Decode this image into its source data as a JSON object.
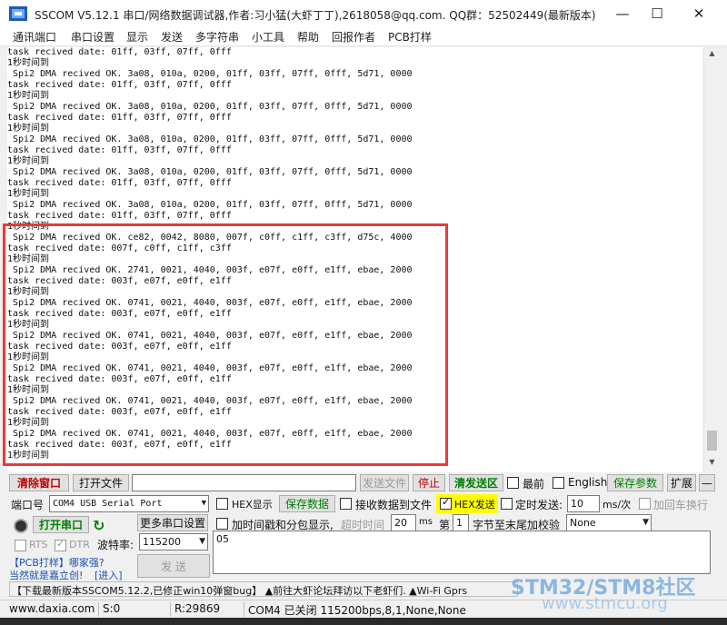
{
  "window": {
    "title": "SSCOM V5.12.1 串口/网络数据调试器,作者:习小猛(大虾丁丁),2618058@qq.com. QQ群：52502449(最新版本)",
    "controls": {
      "minimize": "—",
      "maximize": "☐",
      "close": "✕"
    }
  },
  "menu": [
    "通讯端口",
    "串口设置",
    "显示",
    "发送",
    "多字符串",
    "小工具",
    "帮助",
    "回报作者",
    "PCB打样"
  ],
  "log": [
    "task recived date: 01ff, 03ff, 07ff, 0fff",
    "1秒时间到",
    " Spi2 DMA recived OK. 3a08, 010a, 0200, 01ff, 03ff, 07ff, 0fff, 5d71, 0000",
    "task recived date: 01ff, 03ff, 07ff, 0fff",
    "1秒时间到",
    " Spi2 DMA recived OK. 3a08, 010a, 0200, 01ff, 03ff, 07ff, 0fff, 5d71, 0000",
    "task recived date: 01ff, 03ff, 07ff, 0fff",
    "1秒时间到",
    " Spi2 DMA recived OK. 3a08, 010a, 0200, 01ff, 03ff, 07ff, 0fff, 5d71, 0000",
    "task recived date: 01ff, 03ff, 07ff, 0fff",
    "1秒时间到",
    " Spi2 DMA recived OK. 3a08, 010a, 0200, 01ff, 03ff, 07ff, 0fff, 5d71, 0000",
    "task recived date: 01ff, 03ff, 07ff, 0fff",
    "1秒时间到",
    " Spi2 DMA recived OK. 3a08, 010a, 0200, 01ff, 03ff, 07ff, 0fff, 5d71, 0000",
    "task recived date: 01ff, 03ff, 07ff, 0fff",
    "1秒时间到",
    " Spi2 DMA recived OK. ce82, 0042, 8080, 007f, c0ff, c1ff, c3ff, d75c, 4000",
    "task recived date: 007f, c0ff, c1ff, c3ff",
    "1秒时间到",
    " Spi2 DMA recived OK. 2741, 0021, 4040, 003f, e07f, e0ff, e1ff, ebae, 2000",
    "task recived date: 003f, e07f, e0ff, e1ff",
    "1秒时间到",
    " Spi2 DMA recived OK. 0741, 0021, 4040, 003f, e07f, e0ff, e1ff, ebae, 2000",
    "task recived date: 003f, e07f, e0ff, e1ff",
    "1秒时间到",
    " Spi2 DMA recived OK. 0741, 0021, 4040, 003f, e07f, e0ff, e1ff, ebae, 2000",
    "task recived date: 003f, e07f, e0ff, e1ff",
    "1秒时间到",
    " Spi2 DMA recived OK. 0741, 0021, 4040, 003f, e07f, e0ff, e1ff, ebae, 2000",
    "task recived date: 003f, e07f, e0ff, e1ff",
    "1秒时间到",
    " Spi2 DMA recived OK. 0741, 0021, 4040, 003f, e07f, e0ff, e1ff, ebae, 2000",
    "task recived date: 003f, e07f, e0ff, e1ff",
    "1秒时间到",
    " Spi2 DMA recived OK. 0741, 0021, 4040, 003f, e07f, e0ff, e1ff, ebae, 2000",
    "task recived date: 003f, e07f, e0ff, e1ff",
    "1秒时间到"
  ],
  "toolbar": {
    "clear_window": "清除窗口",
    "open_file": "打开文件",
    "file_path": "",
    "send_file": "发送文件",
    "stop": "停止",
    "clear_send": "清发送区",
    "topmost": "最前",
    "english": "English",
    "save_params": "保存参数",
    "expand": "扩展",
    "collapse": "—"
  },
  "port": {
    "label": "端口号",
    "value": "COM4 USB Serial Port",
    "open_button": "打开串口",
    "more_settings": "更多串口设置",
    "baud_label": "波特率:",
    "baud_value": "115200",
    "rts": "RTS",
    "dtr": "DTR"
  },
  "display": {
    "hex_display": "HEX显示",
    "save_data": "保存数据",
    "recv_to_file": "接收数据到文件",
    "timestamp": "加时间戳和分包显示,",
    "timeout_label": "超时时间",
    "timeout_value": "20",
    "timeout_unit": "ms",
    "frame_label": "第",
    "frame_value": "1",
    "checksum_label": "字节至末尾加校验",
    "checksum_value": "None"
  },
  "send": {
    "hex_send": "HEX发送",
    "timed_send": "定时发送:",
    "interval_value": "10",
    "interval_unit": "ms/次",
    "add_crlf": "加回车换行",
    "input_value": "05",
    "send_button": "发  送"
  },
  "promo": {
    "line1": "【PCB打样】哪家强?",
    "line2a": "当然就是嘉立创!",
    "line2b": "[进入]",
    "ticker": "【下载最新版本SSCOM5.12.2,已修正win10弹窗bug】      ▲前往大虾论坛拜访以下老虾们.  ▲Wi-Fi Gprs"
  },
  "status": {
    "website": "www.daxia.com",
    "sent": "S:0",
    "received": "R:29869",
    "port_state": "COM4 已关闭  115200bps,8,1,None,None"
  },
  "watermark": {
    "line1": "STM32/STM8社区",
    "line2": "www.stmcu.org"
  },
  "colors": {
    "highlight": "#e83a3a",
    "hex_send_bg": "#ffff00",
    "accent_green": "#008000",
    "danger_red": "#c00000"
  }
}
